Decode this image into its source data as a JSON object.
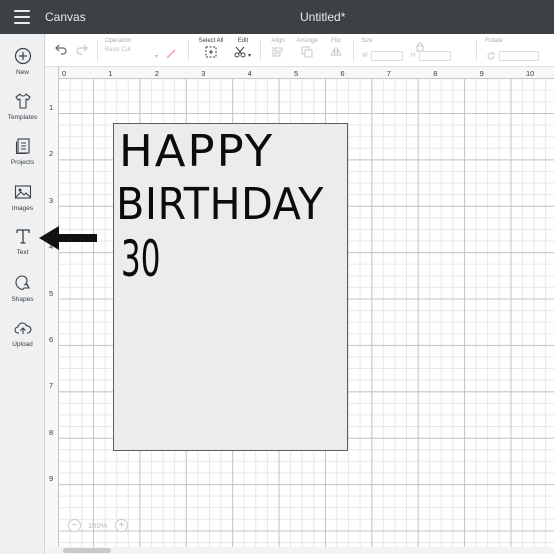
{
  "header": {
    "app_title": "Canvas",
    "doc_title": "Untitled*"
  },
  "sidebar": {
    "items": [
      {
        "label": "New",
        "icon": "plus-circle-icon"
      },
      {
        "label": "Templates",
        "icon": "tshirt-icon"
      },
      {
        "label": "Projects",
        "icon": "projects-icon"
      },
      {
        "label": "Images",
        "icon": "image-icon"
      },
      {
        "label": "Text",
        "icon": "text-T-icon"
      },
      {
        "label": "Shapes",
        "icon": "shapes-icon"
      },
      {
        "label": "Upload",
        "icon": "upload-cloud-icon"
      }
    ]
  },
  "toolbar": {
    "operation_label": "Operation",
    "operation_value": "Basic Cut",
    "select_all_label": "Select All",
    "edit_label": "Edit",
    "align_label": "Align",
    "arrange_label": "Arrange",
    "flip_label": "Flip",
    "size_label": "Size",
    "size_w": "W",
    "size_h": "H",
    "rotate_label": "Rotate"
  },
  "ruler": {
    "top": [
      "0",
      "1",
      "2",
      "3",
      "4",
      "5",
      "6",
      "7",
      "8",
      "9",
      "10"
    ],
    "left": [
      "1",
      "2",
      "3",
      "4",
      "5",
      "6",
      "7",
      "8",
      "9"
    ]
  },
  "card": {
    "line1": "HAPPY",
    "line2": "BIRTHDAY",
    "line3": "30"
  },
  "zoom": {
    "value": "100%",
    "minus": "−",
    "plus": "+"
  },
  "colors": {
    "header_bg": "#3d4145",
    "sidebar_bg": "#eef0f1",
    "card_bg": "#ececec"
  }
}
